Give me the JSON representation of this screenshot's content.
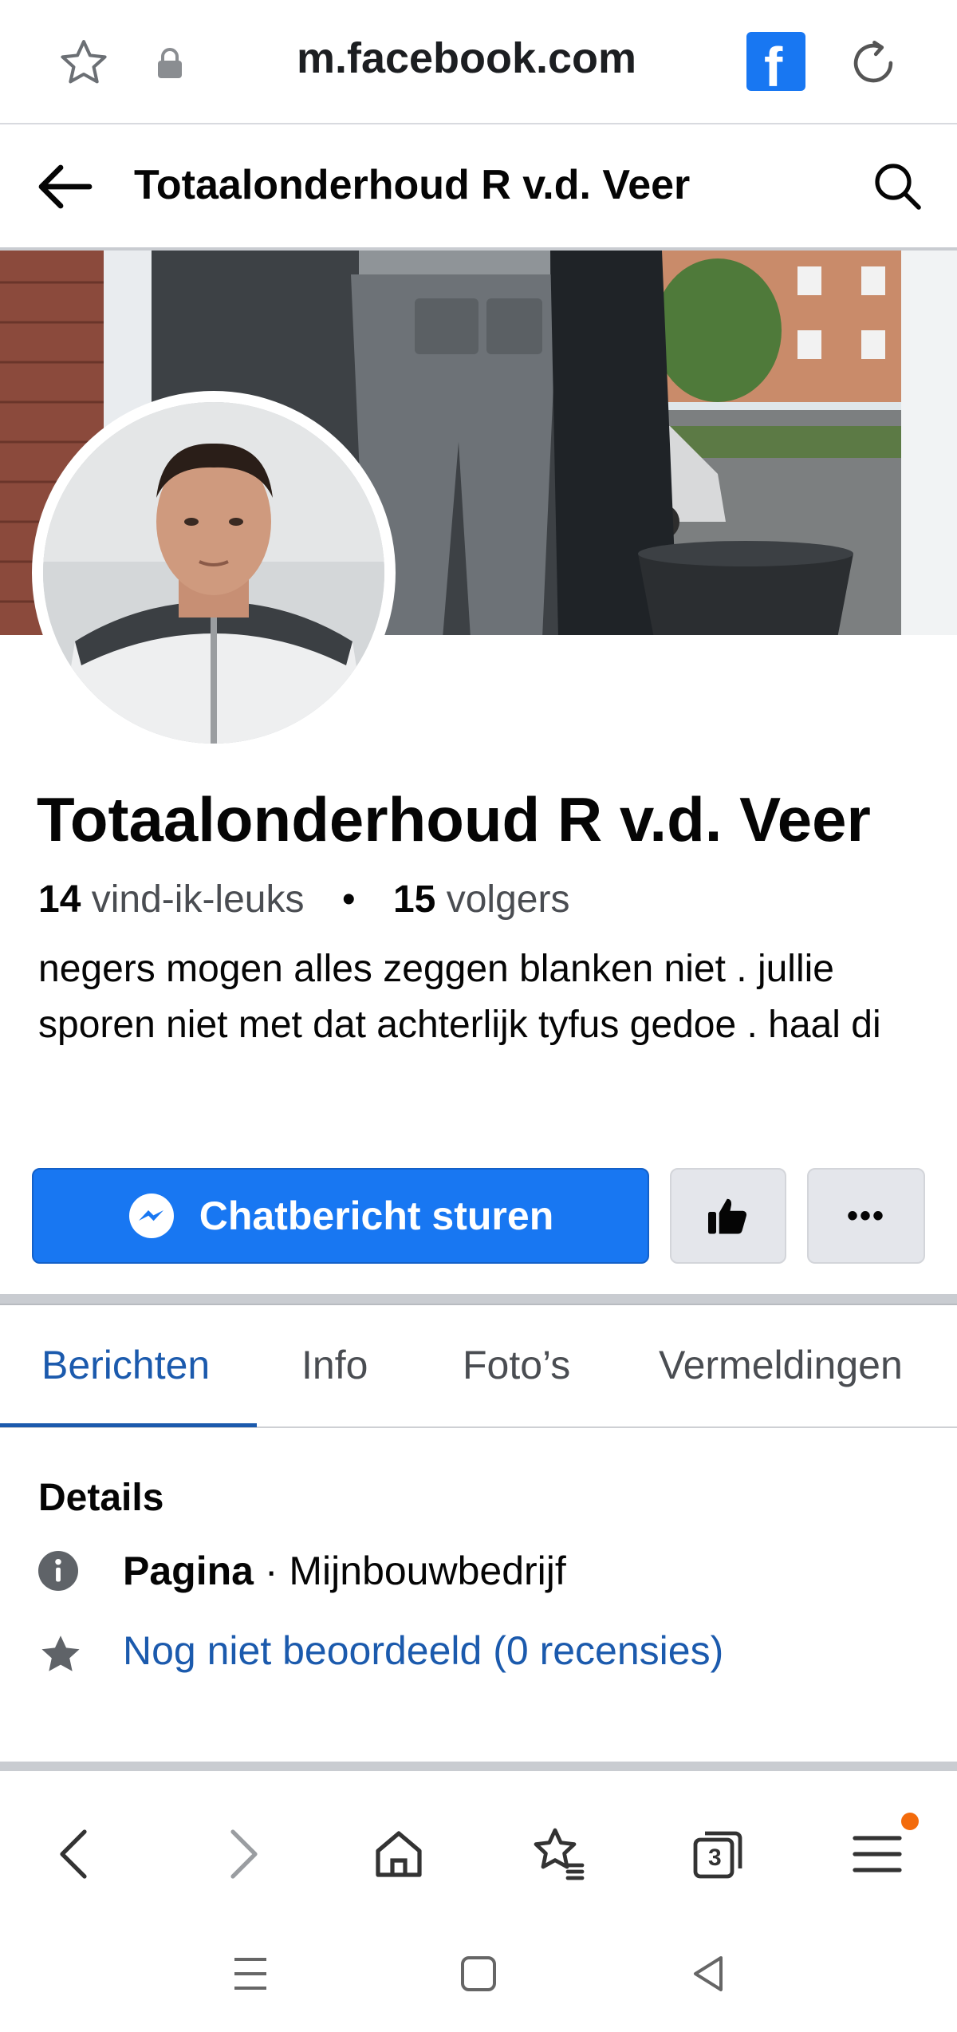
{
  "browser": {
    "url": "m.facebook.com",
    "icons": [
      "star-outline-icon",
      "lock-icon",
      "facebook-logo-icon",
      "reload-icon"
    ],
    "fb_logo_letter": "f",
    "fb_color": "#1877f2"
  },
  "header": {
    "title": "Totaalonderhoud R v.d. Veer",
    "icons": [
      "back-arrow-icon",
      "search-icon"
    ]
  },
  "profile": {
    "name": "Totaalonderhoud R v.d. Veer",
    "likes_count": "14",
    "likes_label": "vind-ik-leuks",
    "separator": "•",
    "followers_count": "15",
    "followers_label": "volgers",
    "bio": "negers mogen alles zeggen blanken niet . jullie sporen niet met dat achterlijk tyfus gedoe . haal di"
  },
  "actions": {
    "chat_label": "Chatbericht sturen",
    "like_icon": "thumbs-up-icon",
    "more_label": "•••",
    "accent": "#1877f2"
  },
  "tabs": [
    {
      "label": "Berichten",
      "active": true
    },
    {
      "label": "Info",
      "active": false
    },
    {
      "label": "Foto’s",
      "active": false
    },
    {
      "label": "Vermeldingen",
      "active": false
    }
  ],
  "details": {
    "heading": "Details",
    "type_label": "Pagina",
    "type_sep": " · ",
    "category": "Mijnbouwbedrijf",
    "rating_text": "Nog niet beoordeeld (0 recensies)"
  },
  "toolbar": {
    "icons": [
      "back-icon",
      "forward-icon",
      "home-icon",
      "bookmarks-icon",
      "tabs-icon",
      "menu-icon"
    ],
    "tabs_count": "3",
    "notification_color": "#f36b0c"
  },
  "system_nav": {
    "icons": [
      "recent-apps-icon",
      "home-square-icon",
      "back-triangle-icon"
    ]
  }
}
